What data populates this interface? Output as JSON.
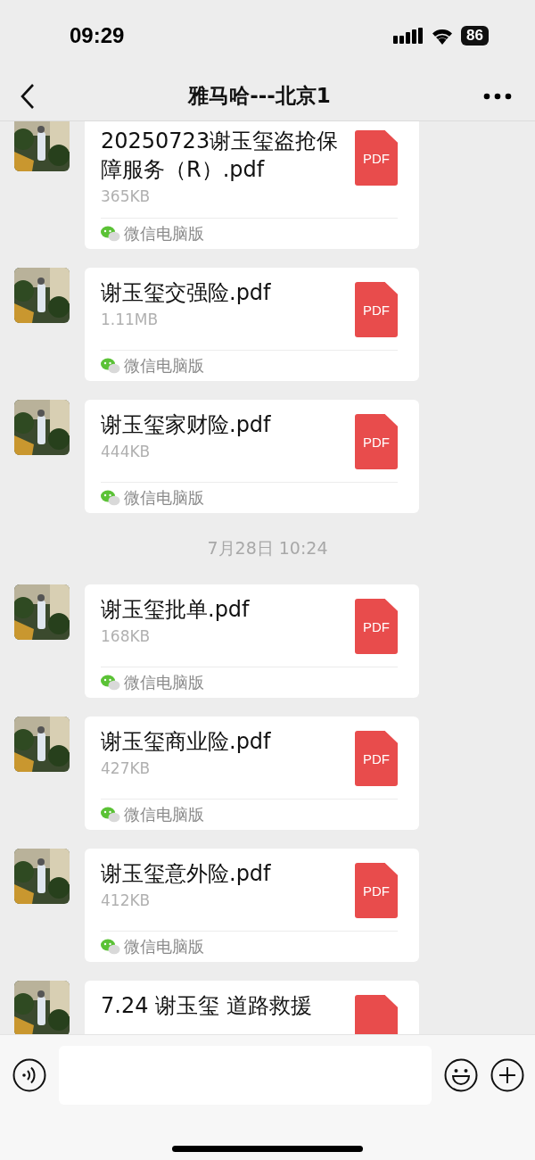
{
  "status_bar": {
    "time": "09:29",
    "battery": "86"
  },
  "header": {
    "title": "雅马哈---北京1"
  },
  "messages": [
    {
      "kind": "file",
      "name": "20250723谢玉玺盗抢保障服务（R）.pdf",
      "size": "365KB",
      "source": "微信电脑版",
      "file_type": "PDF"
    },
    {
      "kind": "file",
      "name": "谢玉玺交强险.pdf",
      "size": "1.11MB",
      "source": "微信电脑版",
      "file_type": "PDF"
    },
    {
      "kind": "file",
      "name": "谢玉玺家财险.pdf",
      "size": "444KB",
      "source": "微信电脑版",
      "file_type": "PDF"
    },
    {
      "kind": "time",
      "text": "7月28日 10:24"
    },
    {
      "kind": "file",
      "name": "谢玉玺批单.pdf",
      "size": "168KB",
      "source": "微信电脑版",
      "file_type": "PDF"
    },
    {
      "kind": "file",
      "name": "谢玉玺商业险.pdf",
      "size": "427KB",
      "source": "微信电脑版",
      "file_type": "PDF"
    },
    {
      "kind": "file",
      "name": "谢玉玺意外险.pdf",
      "size": "412KB",
      "source": "微信电脑版",
      "file_type": "PDF"
    },
    {
      "kind": "file",
      "name": "7.24 谢玉玺 道路救援"
    }
  ]
}
